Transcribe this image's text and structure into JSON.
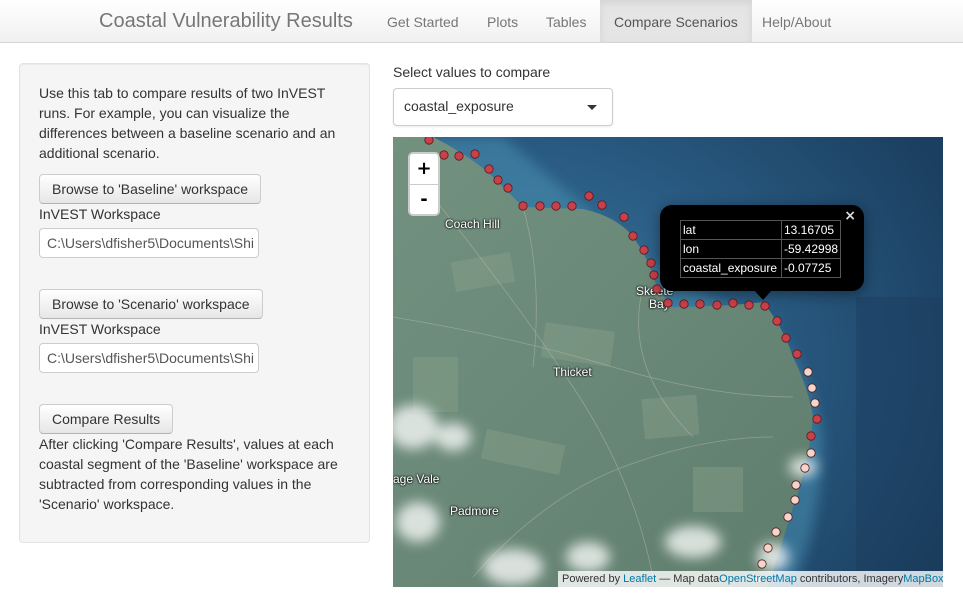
{
  "navbar": {
    "brand": "Coastal Vulnerability Results",
    "tabs": [
      {
        "label": "Get Started"
      },
      {
        "label": "Plots"
      },
      {
        "label": "Tables"
      },
      {
        "label": "Compare Scenarios",
        "active": true
      },
      {
        "label": "Help/About"
      }
    ]
  },
  "sidebar": {
    "intro": "Use this tab to compare results of two InVEST runs. For example, you can visualize the differences between a baseline scenario and an additional scenario.",
    "baseline_button": "Browse to 'Baseline' workspace",
    "baseline_label": "InVEST Workspace",
    "baseline_path": "C:\\Users\\dfisher5\\Documents\\Shi",
    "scenario_button": "Browse to 'Scenario' workspace",
    "scenario_label": "InVEST Workspace",
    "scenario_path": "C:\\Users\\dfisher5\\Documents\\Shi",
    "compare_button": "Compare Results",
    "outro": "After clicking 'Compare Results', values at each coastal segment of the 'Baseline' workspace are subtracted from corresponding values in the 'Scenario' workspace."
  },
  "compare": {
    "label": "Select values to compare",
    "selected": "coastal_exposure"
  },
  "map": {
    "zoom_in": "+",
    "zoom_out": "-",
    "places": {
      "coach_hill": "Coach Hill",
      "skeete": "Skeete",
      "bay": "Bay",
      "thicket": "Thicket",
      "age_vale": "age Vale",
      "padmore": "Padmore"
    },
    "colors": {
      "water": "#1b3f60",
      "land": "#6b8a7a",
      "point_red": "#c9404a",
      "point_light": "#f0d6cc"
    },
    "popup": {
      "close": "×",
      "rows": [
        {
          "key": "lat",
          "value": "13.16705"
        },
        {
          "key": "lon",
          "value": "-59.42998"
        },
        {
          "key": "coastal_exposure",
          "value": "-0.07725"
        }
      ]
    },
    "attribution": {
      "prefix": "Powered by ",
      "leaflet": "Leaflet",
      "mid": " — Map data",
      "osm": "OpenStreetMap",
      "contrib": " contributors, Imagery",
      "mapbox": "MapBox"
    }
  }
}
